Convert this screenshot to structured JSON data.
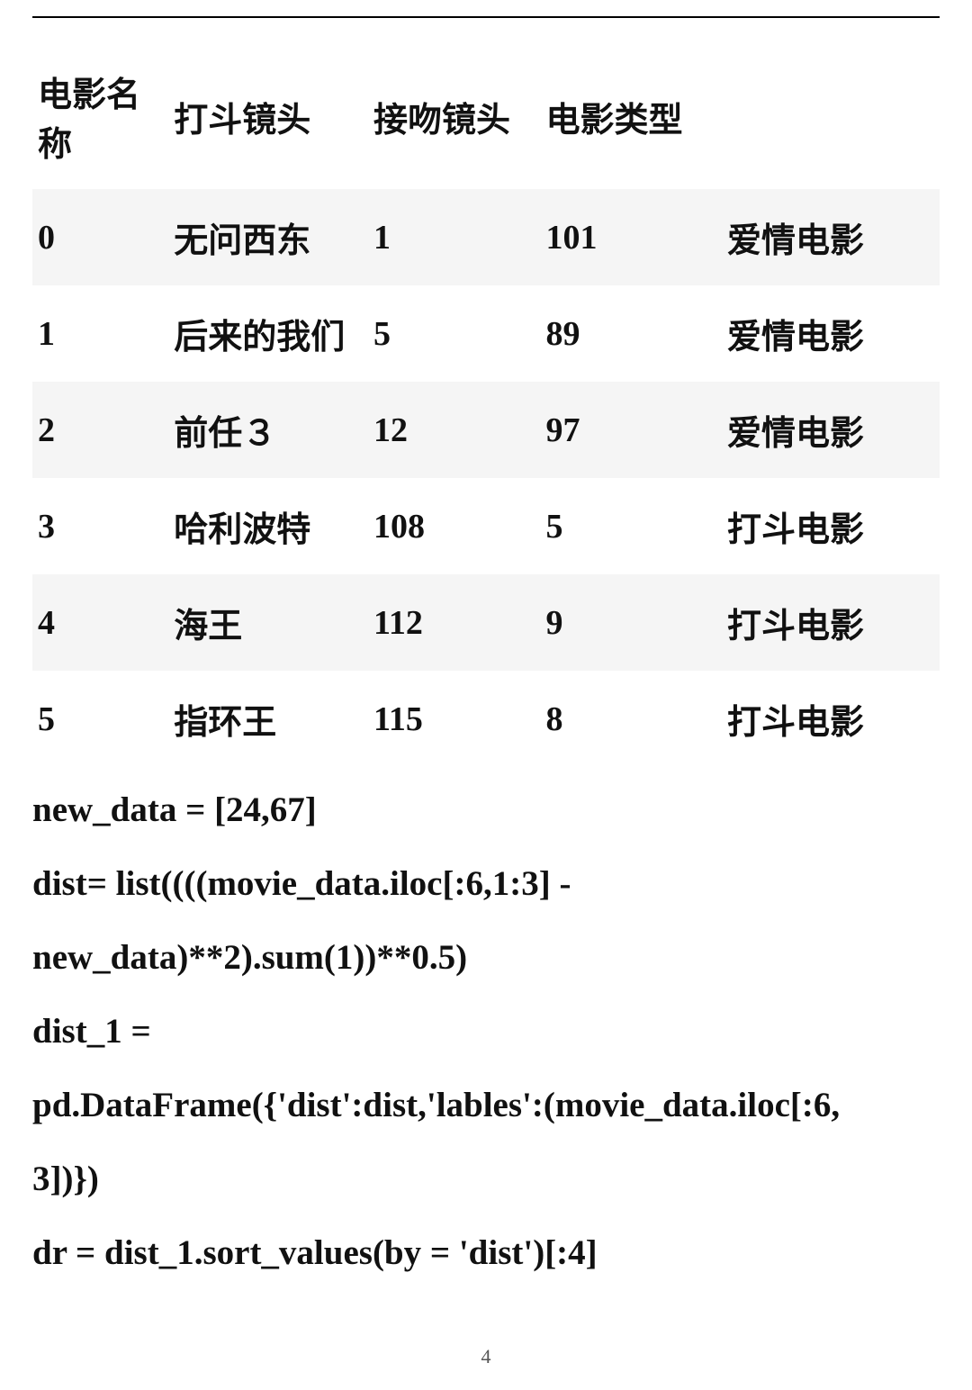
{
  "table": {
    "headers": [
      "电影名称",
      "打斗镜头",
      "接吻镜头",
      "电影类型"
    ],
    "rows": [
      {
        "index": "0",
        "c1": "无问西东",
        "c2": "1",
        "c3": "101",
        "c4": "爱情电影"
      },
      {
        "index": "1",
        "c1": "后来的我们",
        "c2": "5",
        "c3": "89",
        "c4": "爱情电影"
      },
      {
        "index": "2",
        "c1": "前任３",
        "c2": "12",
        "c3": "97",
        "c4": "爱情电影"
      },
      {
        "index": "3",
        "c1": "哈利波特",
        "c2": "108",
        "c3": "5",
        "c4": "打斗电影"
      },
      {
        "index": "4",
        "c1": "海王",
        "c2": "112",
        "c3": "9",
        "c4": "打斗电影"
      },
      {
        "index": "5",
        "c1": "指环王",
        "c2": "115",
        "c3": "8",
        "c4": "打斗电影"
      }
    ]
  },
  "code": {
    "line1": "new_data = [24,67]",
    "line2": "dist= list((((movie_data.iloc[:6,1:3] -",
    "line3": "new_data)**2).sum(1))**0.5)",
    "line4": "dist_1 =",
    "line5": "pd.DataFrame({'dist':dist,'lables':(movie_data.iloc[:6,",
    "line6": "3])})",
    "line7": "dr = dist_1.sort_values(by = 'dist')[:4]"
  },
  "page_number": "4",
  "chart_data": {
    "type": "table",
    "title": "",
    "columns": [
      "电影名称",
      "打斗镜头",
      "接吻镜头",
      "电影类型"
    ],
    "rows": [
      [
        "无问西东",
        1,
        101,
        "爱情电影"
      ],
      [
        "后来的我们",
        5,
        89,
        "爱情电影"
      ],
      [
        "前任３",
        12,
        97,
        "爱情电影"
      ],
      [
        "哈利波特",
        108,
        5,
        "打斗电影"
      ],
      [
        "海王",
        112,
        9,
        "打斗电影"
      ],
      [
        "指环王",
        115,
        8,
        "打斗电影"
      ]
    ]
  }
}
